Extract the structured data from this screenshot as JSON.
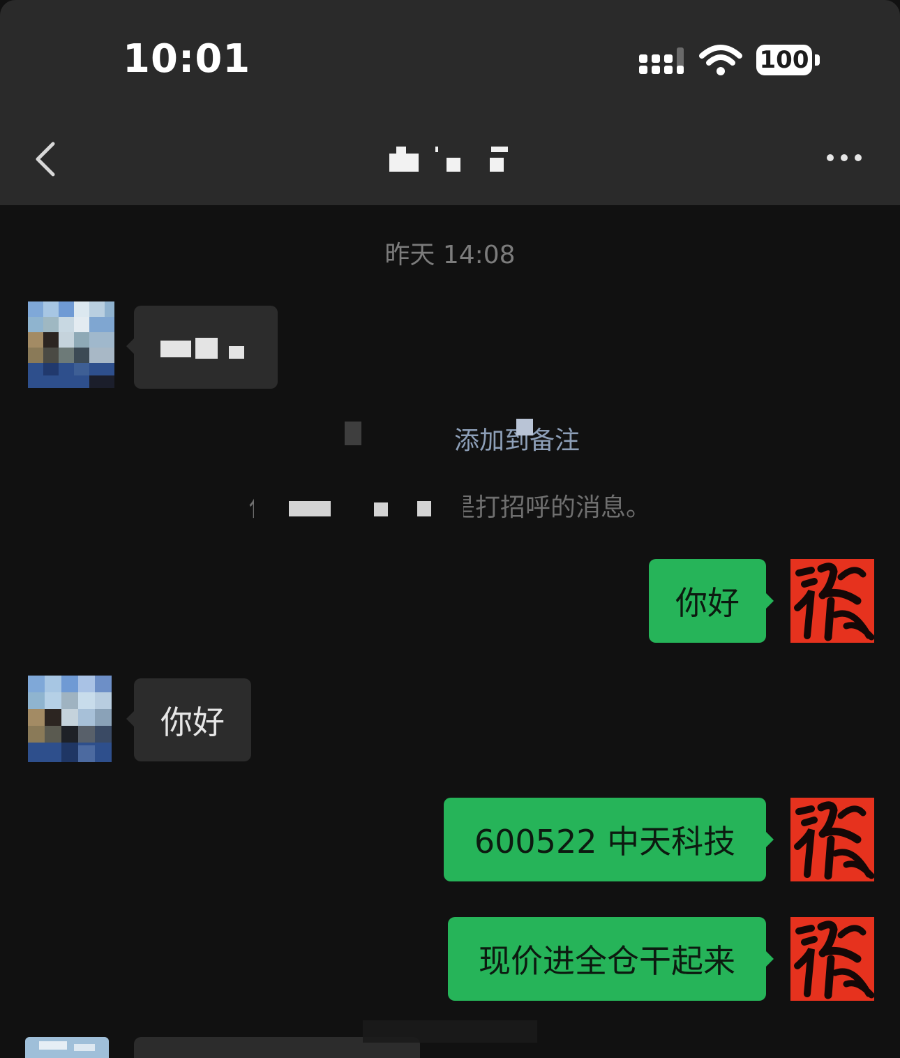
{
  "status_bar": {
    "time": "10:01",
    "battery": "100"
  },
  "nav": {
    "title": "A Y",
    "back_icon": "chevron-left-icon",
    "more_icon": "ellipsis-icon"
  },
  "chat": {
    "timestamp": "昨天 14:08",
    "messages": [
      {
        "from": "other",
        "text": "云是"
      },
      {
        "from": "system",
        "style": "link",
        "text": "添加到备注"
      },
      {
        "from": "system",
        "style": "gray",
        "text": "你已添加了，以上是打招呼的消息。"
      },
      {
        "from": "me",
        "text": "你好"
      },
      {
        "from": "other",
        "text": "你好"
      },
      {
        "from": "me",
        "text": "600522 中天科技"
      },
      {
        "from": "me",
        "text": "现价进全仓干起来"
      }
    ]
  },
  "colors": {
    "background": "#111111",
    "header": "#2a2a2a",
    "bubble_out": "#26b459",
    "bubble_in": "#2c2c2c",
    "self_avatar": "#e6321e"
  }
}
